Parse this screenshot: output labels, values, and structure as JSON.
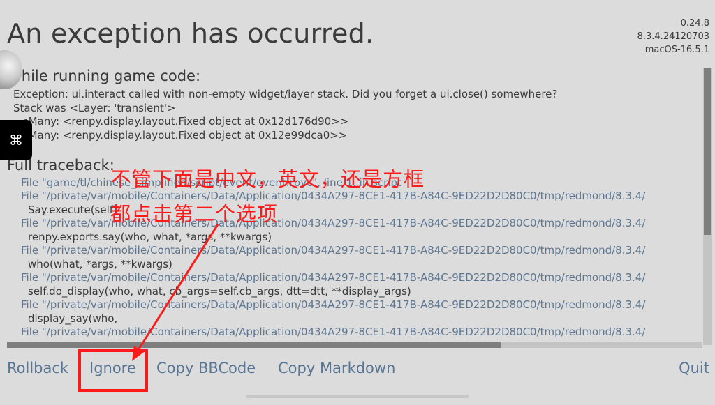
{
  "header": {
    "title": "An exception has occurred.",
    "version_lines": [
      "0.24.8",
      "8.3.4.24120703",
      "macOS-16.5.1"
    ]
  },
  "exception_section": {
    "heading": "While running game code:",
    "lines": [
      "Exception: ui.interact called with non-empty widget/layer stack. Did you forget a ui.close() somewhere?",
      "Stack was <Layer: 'transient'>",
      "<Many: <renpy.display.layout.Fixed object at 0x12d176d90>>",
      "<Many: <renpy.display.layout.Fixed object at 0x12e99dca0>>"
    ]
  },
  "traceback_section": {
    "heading": "Full traceback:",
    "lines": [
      {
        "kind": "file",
        "text": "File \"game/tl/chinese_simplified/script/event/event.rpyc\", line 1, in script"
      },
      {
        "kind": "file",
        "text": "File \"/private/var/mobile/Containers/Data/Application/0434A297-8CE1-417B-A84C-9ED22D2D80C0/tmp/redmond/8.3.4/"
      },
      {
        "kind": "code",
        "text": "Say.execute(self)"
      },
      {
        "kind": "file",
        "text": "File \"/private/var/mobile/Containers/Data/Application/0434A297-8CE1-417B-A84C-9ED22D2D80C0/tmp/redmond/8.3.4/"
      },
      {
        "kind": "code",
        "text": "renpy.exports.say(who, what, *args, **kwargs)"
      },
      {
        "kind": "file",
        "text": "File \"/private/var/mobile/Containers/Data/Application/0434A297-8CE1-417B-A84C-9ED22D2D80C0/tmp/redmond/8.3.4/"
      },
      {
        "kind": "code",
        "text": "who(what, *args, **kwargs)"
      },
      {
        "kind": "file",
        "text": "File \"/private/var/mobile/Containers/Data/Application/0434A297-8CE1-417B-A84C-9ED22D2D80C0/tmp/redmond/8.3.4/"
      },
      {
        "kind": "code",
        "text": "self.do_display(who, what, cb_args=self.cb_args, dtt=dtt, **display_args)"
      },
      {
        "kind": "file",
        "text": "File \"/private/var/mobile/Containers/Data/Application/0434A297-8CE1-417B-A84C-9ED22D2D80C0/tmp/redmond/8.3.4/"
      },
      {
        "kind": "code",
        "text": "display_say(who,"
      },
      {
        "kind": "file",
        "text": "File \"/private/var/mobile/Containers/Data/Application/0434A297-8CE1-417B-A84C-9ED22D2D80C0/tmp/redmond/8.3.4/"
      }
    ]
  },
  "buttons": {
    "rollback": "Rollback",
    "ignore": "Ignore",
    "copy_bbcode": "Copy BBCode",
    "copy_markdown": "Copy Markdown",
    "quit": "Quit"
  },
  "annotation": {
    "line1": "不管下面是中文，英文，还是方框",
    "line2": "都点击第二个选项",
    "color": "#ff1a1a"
  },
  "side_widget": {
    "icon": "command-icon",
    "glyph": "⌘"
  },
  "colors": {
    "background": "#dcdcdc",
    "link": "#587694",
    "file_line": "#5e7690",
    "text": "#3a3a3a"
  }
}
